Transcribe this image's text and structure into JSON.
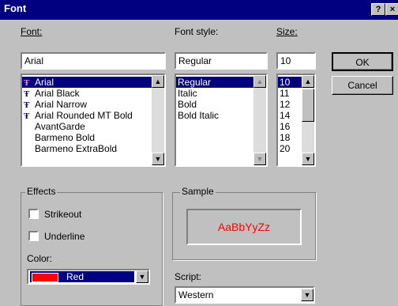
{
  "window": {
    "title": "Font",
    "help_button": "?",
    "close_button": "×"
  },
  "font": {
    "label": "Font:",
    "value": "Arial",
    "items": [
      {
        "label": "Arial",
        "truetype": true,
        "selected": true
      },
      {
        "label": "Arial Black",
        "truetype": true,
        "selected": false
      },
      {
        "label": "Arial Narrow",
        "truetype": true,
        "selected": false
      },
      {
        "label": "Arial Rounded MT Bold",
        "truetype": true,
        "selected": false
      },
      {
        "label": "AvantGarde",
        "truetype": false,
        "selected": false
      },
      {
        "label": "Barmeno Bold",
        "truetype": false,
        "selected": false
      },
      {
        "label": "Barmeno ExtraBold",
        "truetype": false,
        "selected": false
      }
    ]
  },
  "style": {
    "label": "Font style:",
    "value": "Regular",
    "items": [
      {
        "label": "Regular",
        "selected": true
      },
      {
        "label": "Italic",
        "selected": false
      },
      {
        "label": "Bold",
        "selected": false
      },
      {
        "label": "Bold Italic",
        "selected": false
      }
    ]
  },
  "size": {
    "label": "Size:",
    "value": "10",
    "items": [
      {
        "label": "10",
        "selected": true
      },
      {
        "label": "11",
        "selected": false
      },
      {
        "label": "12",
        "selected": false
      },
      {
        "label": "14",
        "selected": false
      },
      {
        "label": "16",
        "selected": false
      },
      {
        "label": "18",
        "selected": false
      },
      {
        "label": "20",
        "selected": false
      }
    ]
  },
  "buttons": {
    "ok": "OK",
    "cancel": "Cancel"
  },
  "effects": {
    "label": "Effects",
    "strikeout": "Strikeout",
    "underline": "Underline",
    "color_label": "Color:",
    "color_value": "Red",
    "color_swatch": "#ff0000"
  },
  "sample": {
    "label": "Sample",
    "text": "AaBbYyZz",
    "color": "#ff0000"
  },
  "script": {
    "label": "Script:",
    "value": "Western"
  }
}
